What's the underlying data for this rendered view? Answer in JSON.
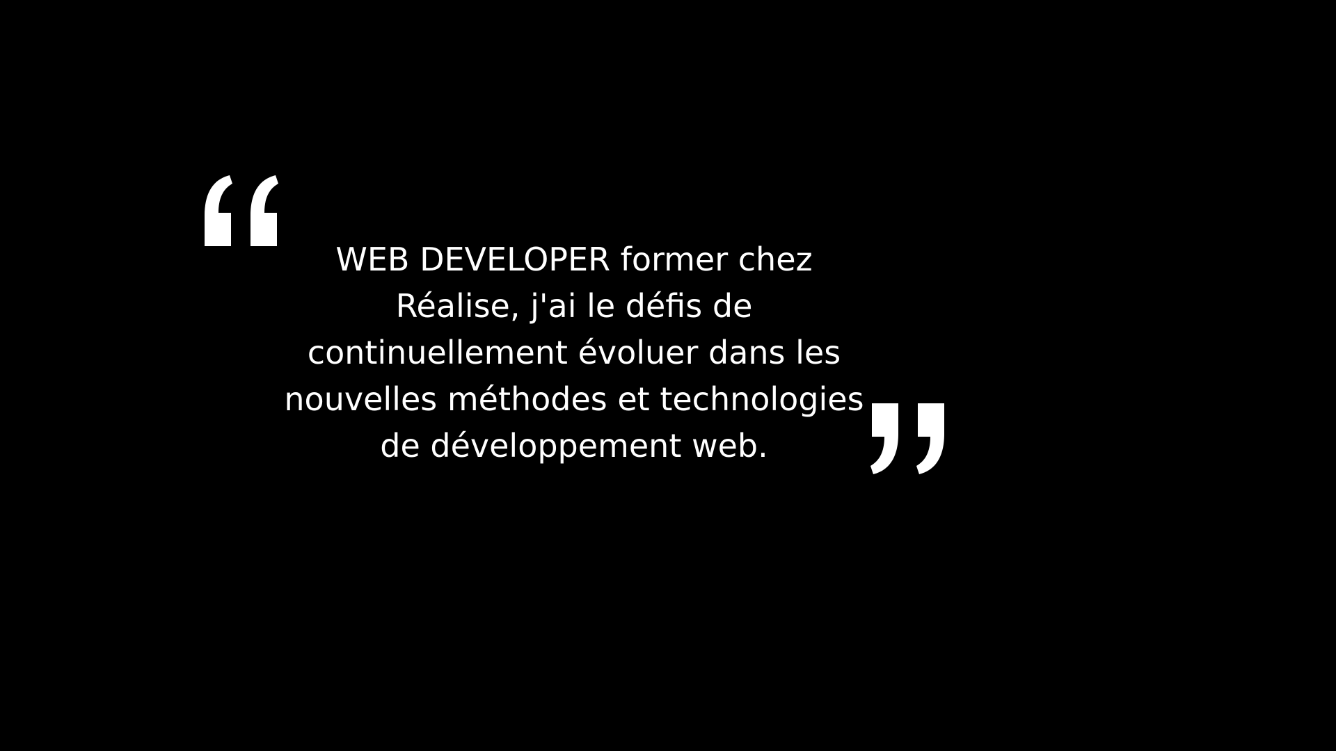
{
  "testimonial": {
    "open_mark_icon": "opening-quotation-mark",
    "close_mark_icon": "closing-quotation-mark",
    "text": "WEB DEVELOPER former chez Réalise, j'ai le défis de continuellement évoluer dans les nouvelles méthodes et technologies de développement web."
  },
  "colors": {
    "background": "#000000",
    "text": "#ffffff"
  }
}
